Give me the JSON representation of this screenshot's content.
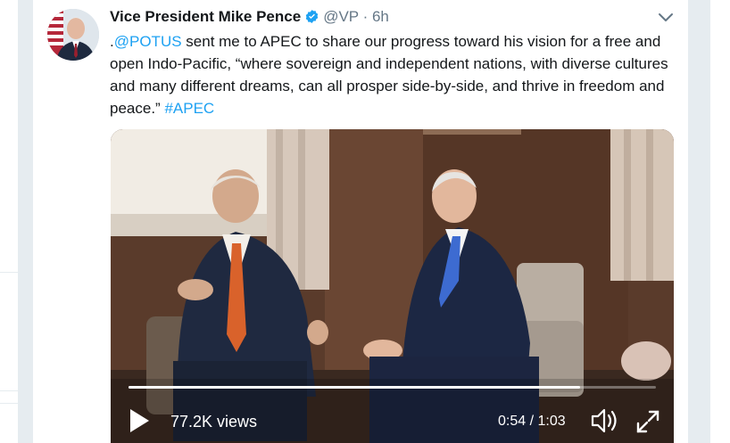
{
  "tweet": {
    "author_name": "Vice President Mike Pence",
    "handle": "@VP",
    "separator": "·",
    "time": "6h",
    "text_prefix": ".",
    "mention": "@POTUS",
    "text_body": " sent me to APEC to share our progress toward his vision for a free and open Indo-Pacific, “where sovereign and independent nations, with diverse cultures and many different dreams, can all prosper side-by-side, and thrive in freedom and peace.” ",
    "hashtag": "#APEC"
  },
  "video": {
    "views": "77.2K views",
    "duration": "0:54 / 1:03",
    "progress": 0.857
  },
  "icons": {
    "verified": "verified-badge-icon",
    "caret": "chevron-down-icon",
    "play": "play-icon",
    "volume": "volume-icon",
    "fullscreen": "fullscreen-icon"
  },
  "colors": {
    "link": "#1da1f2",
    "verified": "#1da1f2",
    "text": "#14171a",
    "secondary": "#657786"
  }
}
